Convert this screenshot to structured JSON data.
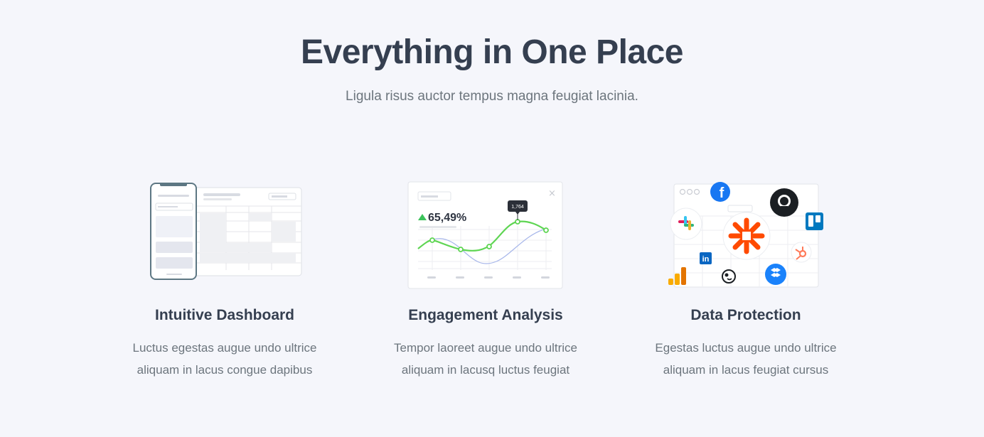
{
  "header": {
    "title": "Everything in One Place",
    "subtitle": "Ligula risus auctor tempus magna feugiat lacinia."
  },
  "features": [
    {
      "title": "Intuitive Dashboard",
      "desc_line1": "Luctus egestas augue undo ultrice",
      "desc_line2": "aliquam in lacus congue dapibus"
    },
    {
      "title": "Engagement Analysis",
      "desc_line1": "Tempor laoreet augue undo ultrice",
      "desc_line2": "aliquam in lacusq luctus feugiat",
      "chart_stat": "65,49%",
      "chart_tooltip": "1,764"
    },
    {
      "title": "Data Protection",
      "desc_line1": "Egestas luctus augue undo ultrice",
      "desc_line2": "aliquam in lacus feugiat cursus",
      "integrations": [
        "facebook-icon",
        "github-icon",
        "slack-icon",
        "zapier-icon",
        "trello-icon",
        "hubspot-icon",
        "linkedin-icon",
        "mailchimp-icon",
        "dropbox-icon",
        "google-analytics-icon"
      ]
    }
  ],
  "colors": {
    "heading": "#353f50",
    "text": "#6c757d",
    "background": "#f5f6fb",
    "chart_green": "#5ed552",
    "zapier": "#ff4a00"
  }
}
